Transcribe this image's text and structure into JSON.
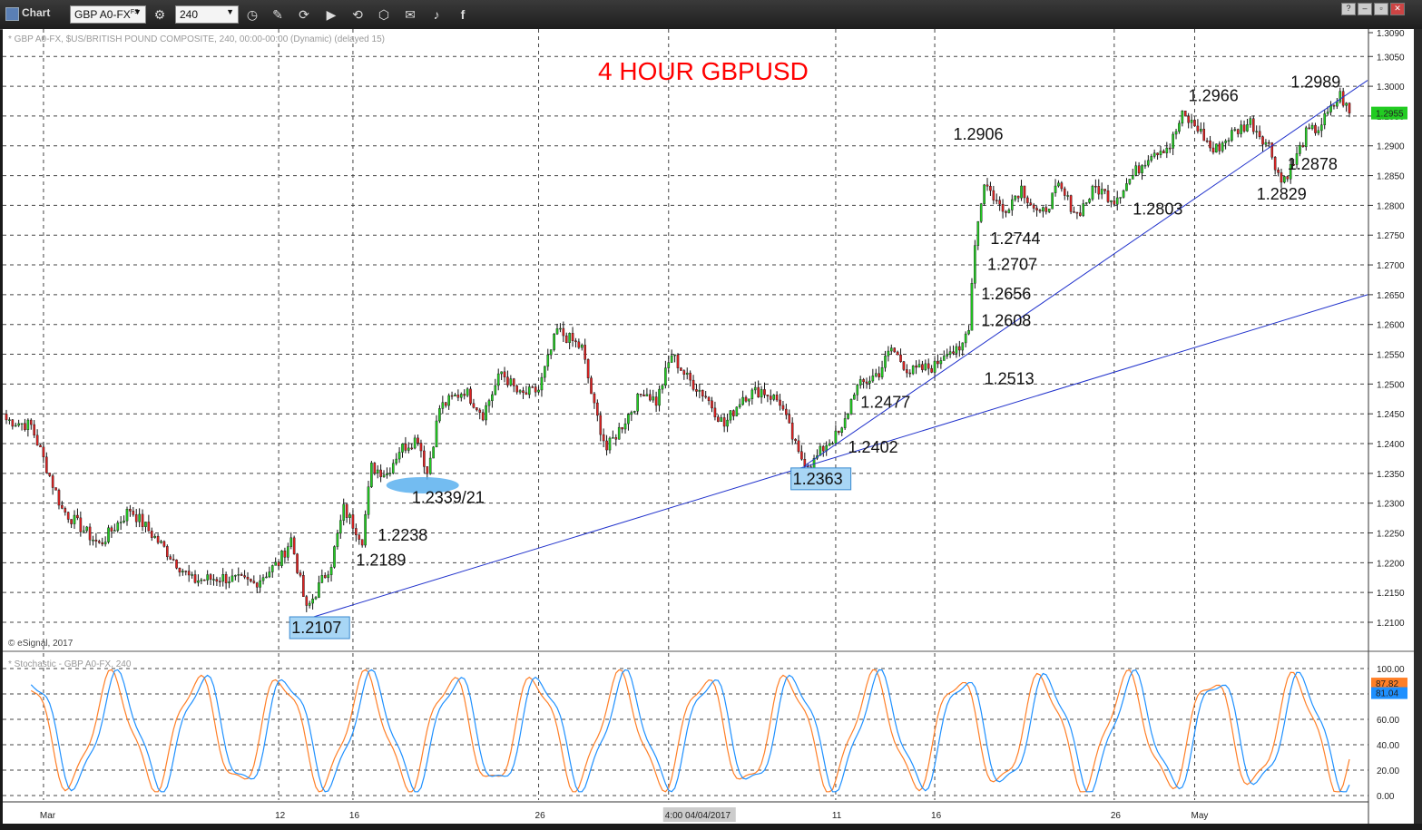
{
  "window": {
    "title": "Chart",
    "symbol": "GBP A0-FX",
    "symbol_superscript": "FS",
    "interval": "240",
    "button_glyphs": [
      "⌁",
      "⟳",
      "▶",
      "⟲",
      "⬡",
      "✉",
      "🐦",
      "f"
    ],
    "window_buttons": [
      "?",
      "–",
      "▫",
      "✕"
    ]
  },
  "chart_header": "* GBP A0-FX, $US/BRITISH POUND COMPOSITE, 240, 00:00-00:00 (Dynamic) (delayed 15)",
  "copyright": "© eSignal, 2017",
  "stoch_header": "* Stochastic - GBP A0-FX, 240",
  "chart_data": {
    "type": "candlestick",
    "title": "4 HOUR GBPUSD",
    "title_color": "#ff0000",
    "up_color": "#22cc22",
    "down_color": "#dd2222",
    "ylim": [
      1.2065,
      1.309
    ],
    "y_ticks": [
      "1.3090",
      "1.3050",
      "1.3000",
      "1.2950",
      "1.2900",
      "1.2850",
      "1.2800",
      "1.2750",
      "1.2700",
      "1.2650",
      "1.2600",
      "1.2550",
      "1.2500",
      "1.2450",
      "1.2400",
      "1.2350",
      "1.2300",
      "1.2250",
      "1.2200",
      "1.2150",
      "1.2100"
    ],
    "last_price": "1.2955",
    "x_ticks": [
      {
        "label": "Mar",
        "i": 12
      },
      {
        "label": "12",
        "i": 88
      },
      {
        "label": "16",
        "i": 112
      },
      {
        "label": "26",
        "i": 172
      },
      {
        "label": "4:00 04/04/2017",
        "i": 214
      },
      {
        "label": "11",
        "i": 268
      },
      {
        "label": "16",
        "i": 300
      },
      {
        "label": "26",
        "i": 358
      },
      {
        "label": "May",
        "i": 384
      }
    ],
    "anchors": [
      [
        0,
        1.244
      ],
      [
        8,
        1.243
      ],
      [
        18,
        1.229
      ],
      [
        30,
        1.223
      ],
      [
        40,
        1.229
      ],
      [
        50,
        1.223
      ],
      [
        60,
        1.217
      ],
      [
        70,
        1.2175
      ],
      [
        80,
        1.2165
      ],
      [
        88,
        1.22
      ],
      [
        92,
        1.224
      ],
      [
        97,
        1.212
      ],
      [
        100,
        1.215
      ],
      [
        105,
        1.22
      ],
      [
        109,
        1.229
      ],
      [
        115,
        1.224
      ],
      [
        118,
        1.236
      ],
      [
        123,
        1.235
      ],
      [
        127,
        1.239
      ],
      [
        133,
        1.241
      ],
      [
        136,
        1.235
      ],
      [
        140,
        1.246
      ],
      [
        148,
        1.249
      ],
      [
        154,
        1.245
      ],
      [
        160,
        1.252
      ],
      [
        166,
        1.248
      ],
      [
        172,
        1.249
      ],
      [
        178,
        1.259
      ],
      [
        186,
        1.256
      ],
      [
        190,
        1.246
      ],
      [
        194,
        1.239
      ],
      [
        200,
        1.244
      ],
      [
        206,
        1.249
      ],
      [
        210,
        1.247
      ],
      [
        215,
        1.255
      ],
      [
        220,
        1.251
      ],
      [
        226,
        1.248
      ],
      [
        232,
        1.243
      ],
      [
        238,
        1.248
      ],
      [
        244,
        1.249
      ],
      [
        250,
        1.247
      ],
      [
        256,
        1.238
      ],
      [
        260,
        1.2363
      ],
      [
        265,
        1.24
      ],
      [
        270,
        1.242
      ],
      [
        274,
        1.249
      ],
      [
        282,
        1.252
      ],
      [
        286,
        1.256
      ],
      [
        292,
        1.252
      ],
      [
        300,
        1.253
      ],
      [
        304,
        1.256
      ],
      [
        308,
        1.255
      ],
      [
        311,
        1.26
      ],
      [
        313,
        1.274
      ],
      [
        316,
        1.284
      ],
      [
        322,
        1.279
      ],
      [
        328,
        1.283
      ],
      [
        334,
        1.278
      ],
      [
        340,
        1.283
      ],
      [
        346,
        1.2785
      ],
      [
        352,
        1.283
      ],
      [
        358,
        1.281
      ],
      [
        364,
        1.285
      ],
      [
        370,
        1.289
      ],
      [
        376,
        1.29
      ],
      [
        380,
        1.295
      ],
      [
        385,
        1.293
      ],
      [
        390,
        1.289
      ],
      [
        396,
        1.292
      ],
      [
        402,
        1.294
      ],
      [
        408,
        1.29
      ],
      [
        412,
        1.284
      ],
      [
        416,
        1.287
      ],
      [
        420,
        1.292
      ],
      [
        424,
        1.293
      ],
      [
        428,
        1.296
      ],
      [
        431,
        1.2985
      ],
      [
        434,
        1.2955
      ]
    ],
    "annotations": [
      {
        "text": "1.2107",
        "x": 1.2107,
        "idx": 98,
        "boxed": true
      },
      {
        "text": "1.2189",
        "idx": 113,
        "y": 1.2195
      },
      {
        "text": "1.2238",
        "idx": 120,
        "y": 1.2237
      },
      {
        "text": "1.2339/21",
        "idx": 131,
        "y": 1.23
      },
      {
        "text": "1.2363",
        "idx": 260,
        "y": 1.2363,
        "boxed": true
      },
      {
        "text": "1.2402",
        "idx": 272,
        "y": 1.2385
      },
      {
        "text": "1.2477",
        "idx": 276,
        "y": 1.246
      },
      {
        "text": "1.2513",
        "idx": 316,
        "y": 1.25
      },
      {
        "text": "1.2608",
        "idx": 315,
        "y": 1.2597
      },
      {
        "text": "1.2656",
        "idx": 315,
        "y": 1.2642
      },
      {
        "text": "1.2707",
        "idx": 317,
        "y": 1.2692
      },
      {
        "text": "1.2744",
        "idx": 318,
        "y": 1.2735
      },
      {
        "text": "1.2906",
        "idx": 306,
        "y": 1.291
      },
      {
        "text": "1.2803",
        "idx": 364,
        "y": 1.2785
      },
      {
        "text": "1.2966",
        "idx": 382,
        "y": 1.2975
      },
      {
        "text": "1.2829",
        "idx": 404,
        "y": 1.281
      },
      {
        "text": "1.2878",
        "idx": 414,
        "y": 1.286
      },
      {
        "text": "1.2989",
        "idx": 415,
        "y": 1.2998
      }
    ],
    "trendlines": [
      {
        "from": [
          98,
          1.2107
        ],
        "to": [
          434,
          1.265
        ]
      },
      {
        "from": [
          258,
          1.2363
        ],
        "to": [
          434,
          1.301
        ]
      }
    ],
    "stochastic": {
      "ylim": [
        0,
        100
      ],
      "y_ticks": [
        "100.00",
        "80.00",
        "60.00",
        "40.00",
        "20.00",
        "0.00"
      ],
      "k_label": "87.82",
      "d_label": "81.04",
      "k_color": "#ff7f27",
      "d_color": "#1e90ff"
    }
  }
}
